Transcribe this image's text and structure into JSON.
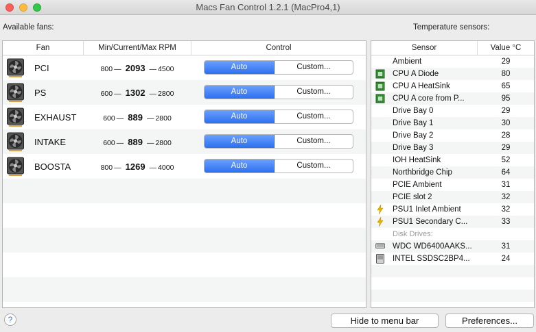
{
  "window": {
    "title": "Macs Fan Control 1.2.1 (MacPro4,1)"
  },
  "labels": {
    "fans": "Available fans:",
    "sensors": "Temperature sensors:"
  },
  "fans_table": {
    "headers": [
      "Fan",
      "Min/Current/Max RPM",
      "Control"
    ],
    "rows": [
      {
        "name": "PCI",
        "min": "800",
        "current": "2093",
        "max": "4500",
        "auto": "Auto",
        "custom": "Custom..."
      },
      {
        "name": "PS",
        "min": "600",
        "current": "1302",
        "max": "2800",
        "auto": "Auto",
        "custom": "Custom..."
      },
      {
        "name": "EXHAUST",
        "min": "600",
        "current": "889",
        "max": "2800",
        "auto": "Auto",
        "custom": "Custom..."
      },
      {
        "name": "INTAKE",
        "min": "600",
        "current": "889",
        "max": "2800",
        "auto": "Auto",
        "custom": "Custom..."
      },
      {
        "name": "BOOSTA",
        "min": "800",
        "current": "1269",
        "max": "4000",
        "auto": "Auto",
        "custom": "Custom..."
      }
    ],
    "dash": "—"
  },
  "sensors_table": {
    "headers": [
      "Sensor",
      "Value °C"
    ],
    "rows": [
      {
        "name": "Ambient",
        "value": "29",
        "icon": "none"
      },
      {
        "name": "CPU A Diode",
        "value": "80",
        "icon": "chip-icon"
      },
      {
        "name": "CPU A HeatSink",
        "value": "65",
        "icon": "chip-icon"
      },
      {
        "name": "CPU A core from P...",
        "value": "95",
        "icon": "chip-icon"
      },
      {
        "name": "Drive Bay 0",
        "value": "29",
        "icon": "none"
      },
      {
        "name": "Drive Bay 1",
        "value": "30",
        "icon": "none"
      },
      {
        "name": "Drive Bay 2",
        "value": "28",
        "icon": "none"
      },
      {
        "name": "Drive Bay 3",
        "value": "29",
        "icon": "none"
      },
      {
        "name": "IOH HeatSink",
        "value": "52",
        "icon": "none"
      },
      {
        "name": "Northbridge Chip",
        "value": "64",
        "icon": "none"
      },
      {
        "name": "PCIE Ambient",
        "value": "31",
        "icon": "none"
      },
      {
        "name": "PCIE slot 2",
        "value": "32",
        "icon": "none"
      },
      {
        "name": "PSU1 Inlet Ambient",
        "value": "32",
        "icon": "lightning-icon"
      },
      {
        "name": "PSU1 Secondary C...",
        "value": "33",
        "icon": "lightning-icon"
      }
    ],
    "disk_header": "Disk Drives:",
    "disks": [
      {
        "name": "WDC WD6400AAKS...",
        "value": "31",
        "icon": "hdd-icon"
      },
      {
        "name": "INTEL SSDSC2BP4...",
        "value": "24",
        "icon": "ssd-icon"
      }
    ]
  },
  "footer": {
    "help": "?",
    "hide": "Hide to menu bar",
    "preferences": "Preferences..."
  },
  "colors": {
    "accent": "#2d6ff0",
    "chip": "#3a9a3a",
    "lightning": "#e6b400"
  }
}
